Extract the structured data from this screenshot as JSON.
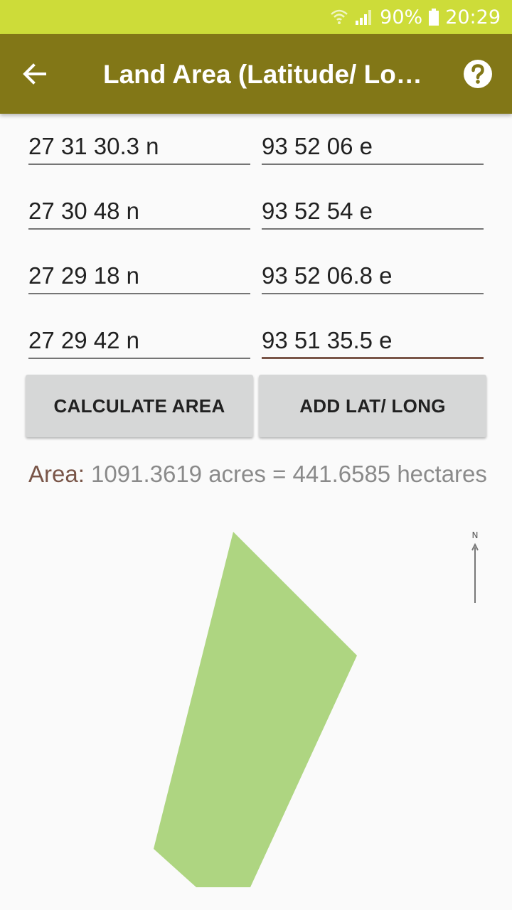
{
  "status_bar": {
    "battery_percent": "90%",
    "time": "20:29"
  },
  "app_bar": {
    "title": "Land Area (Latitude/ Lo…",
    "back_icon": "arrow-back-icon",
    "help_icon": "help-circle-icon"
  },
  "coordinates": [
    {
      "latitude": "27 31 30.3 n",
      "longitude": "93 52 06 e"
    },
    {
      "latitude": "27 30 48 n",
      "longitude": "93 52 54 e"
    },
    {
      "latitude": "27 29 18 n",
      "longitude": "93 52 06.8 e"
    },
    {
      "latitude": "27 29 42 n",
      "longitude": "93 51 35.5 e"
    }
  ],
  "buttons": {
    "calculate": "CALCULATE AREA",
    "add": "ADD LAT/ LONG"
  },
  "result": {
    "label": "Area:",
    "text": " 1091.3619 acres = 441.6585 hectares"
  },
  "map": {
    "north_label": "N",
    "polygon_color": "#aed581"
  },
  "colors": {
    "status_bar": "#cddc39",
    "app_bar": "#827717",
    "accent": "#795548"
  }
}
